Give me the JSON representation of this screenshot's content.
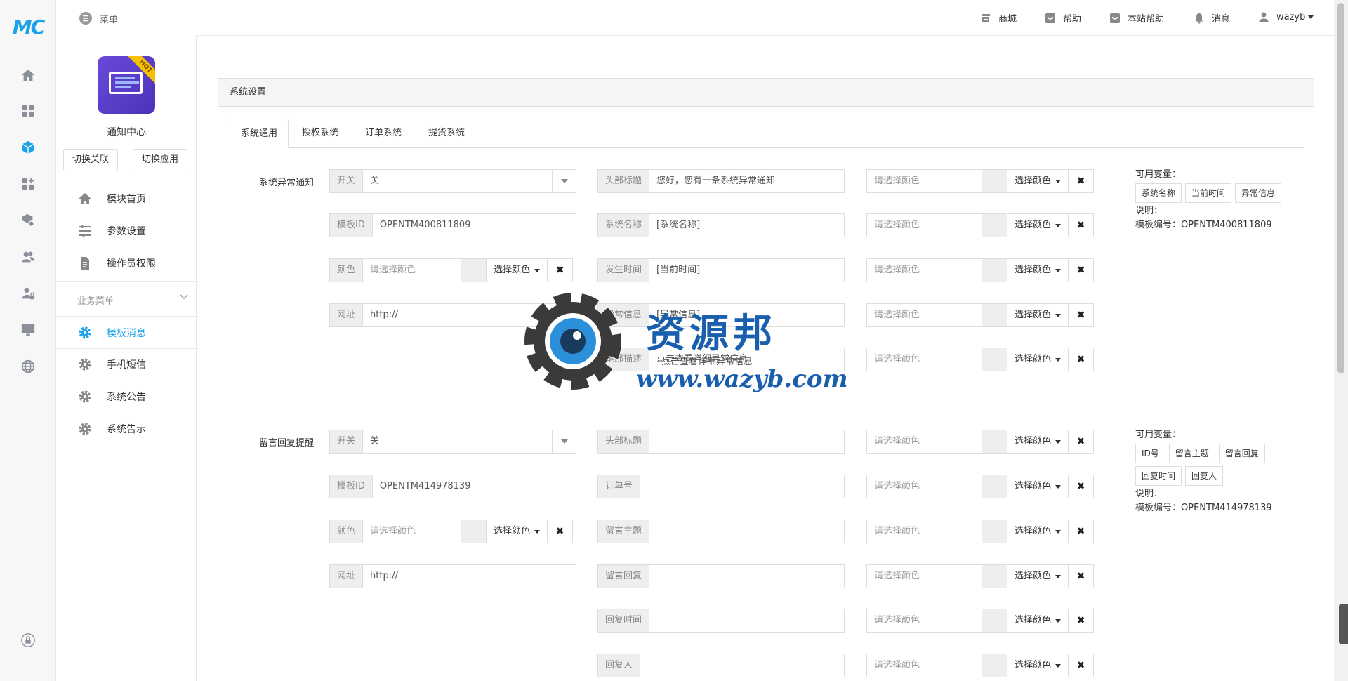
{
  "logo": "MC",
  "topbar": {
    "menu_label": "菜单",
    "nav": [
      {
        "icon": "store-icon",
        "label": "商城"
      },
      {
        "icon": "help-icon",
        "label": "帮助"
      },
      {
        "icon": "site-help-icon",
        "label": "本站帮助"
      },
      {
        "icon": "bell-icon",
        "label": "消息"
      },
      {
        "icon": "user-icon",
        "label": "wazyb"
      }
    ]
  },
  "sidebar": {
    "app_badge": "HOT",
    "app_name": "通知中心",
    "switch_related": "切换关联",
    "switch_app": "切换应用",
    "items": [
      {
        "icon": "home-icon",
        "label": "模块首页"
      },
      {
        "icon": "sliders-icon",
        "label": "参数设置"
      },
      {
        "icon": "document-icon",
        "label": "操作员权限"
      }
    ],
    "group_title": "业务菜单",
    "group_items": [
      {
        "icon": "gear-icon",
        "label": "模板消息",
        "active": true
      },
      {
        "icon": "gear-icon",
        "label": "手机短信"
      },
      {
        "icon": "gear-icon",
        "label": "系统公告"
      },
      {
        "icon": "gear-icon",
        "label": "系统告示"
      }
    ]
  },
  "panel": {
    "title": "系统设置",
    "tabs": [
      "系统通用",
      "授权系统",
      "订单系统",
      "提货系统"
    ],
    "active_tab": 0
  },
  "common": {
    "switch": "开关",
    "off": "关",
    "template_id": "模板ID",
    "color": "颜色",
    "url": "网址",
    "url_value": "http://",
    "color_placeholder": "请选择颜色",
    "pick_color": "选择颜色",
    "clear": "✖",
    "vars_title": "可用变量：",
    "note": "说明："
  },
  "section1": {
    "label": "系统异常通知",
    "template_id": "OPENTM400811809",
    "fields": [
      {
        "label": "头部标题",
        "value": "您好，您有一条系统异常通知"
      },
      {
        "label": "系统名称",
        "value": "[系统名称]"
      },
      {
        "label": "发生时间",
        "value": "[当前时间]"
      },
      {
        "label": "异常信息",
        "value": "[异常信息]"
      },
      {
        "label": "尾部描述",
        "value": "点击查看详细异常信息"
      }
    ],
    "vars": [
      "系统名称",
      "当前时间",
      "异常信息"
    ],
    "template_no": "模板编号：OPENTM400811809"
  },
  "section2": {
    "label": "留言回复提醒",
    "template_id": "OPENTM414978139",
    "fields": [
      {
        "label": "头部标题",
        "value": ""
      },
      {
        "label": "订单号",
        "value": ""
      },
      {
        "label": "留言主题",
        "value": ""
      },
      {
        "label": "留言回复",
        "value": ""
      },
      {
        "label": "回复时间",
        "value": ""
      },
      {
        "label": "回复人",
        "value": ""
      }
    ],
    "vars": [
      "ID号",
      "留言主题",
      "留言回复",
      "回复时间",
      "回复人"
    ],
    "template_no": "模板编号：OPENTM414978139"
  },
  "watermark": {
    "title": "资源邦",
    "subtitle": "点击查看详细异常信息",
    "url": "www.wazyb.com"
  }
}
